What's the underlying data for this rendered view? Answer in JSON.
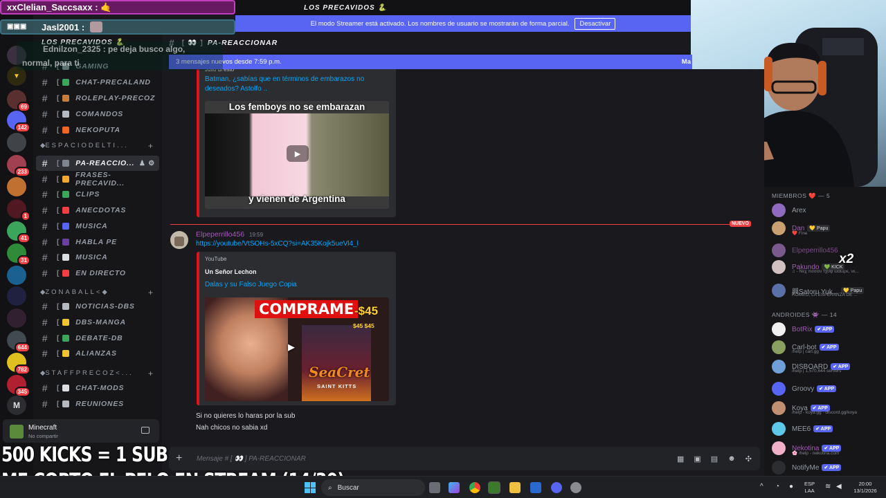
{
  "server": {
    "name": "LOS PRECAVIDOS 🐍",
    "title": "LOS PRECAVIDOS 🐍"
  },
  "streamer_bar": {
    "text": "El modo Streamer está activado. Los nombres de usuario se mostrarán de forma parcial.",
    "button": "Desactivar"
  },
  "channel_header": {
    "name": "PA-REACCIONAR",
    "bracket": "[ 👀 ]"
  },
  "new_messages": {
    "text": "3 mensajes nuevos desde 7:59 p.m.",
    "right": "Ma"
  },
  "rail_badges": [
    "69",
    "142",
    "233",
    "1",
    "41",
    "31",
    "644",
    "782",
    "345"
  ],
  "rail_letter": "M",
  "channels": [
    {
      "label": "GAMING",
      "color": "#949ba4"
    },
    {
      "label": "CHAT-PRECALAND",
      "color": "#3ba55c"
    },
    {
      "label": "ROLEPLAY-PRECOZ",
      "color": "#c77d3c"
    },
    {
      "label": "COMANDOS",
      "color": "#b5bac1"
    },
    {
      "label": "NEKOPUTA",
      "color": "#f26522"
    }
  ],
  "categories": [
    {
      "label": "ESPACIODELTI..."
    },
    {
      "label": "ZONABALL<◆"
    },
    {
      "label": "STAFFPRECOZ<..."
    }
  ],
  "espacio_channels": [
    {
      "label": "PA-REACCIO...",
      "color": "#80848e",
      "active": true
    },
    {
      "label": "FRASES-PRECAVID...",
      "color": "#f0a830"
    },
    {
      "label": "CLIPS",
      "color": "#3ba55c"
    },
    {
      "label": "ANECDOTAS",
      "color": "#f23f43"
    },
    {
      "label": "MUSICA",
      "color": "#5865f2"
    },
    {
      "label": "HABLA PE",
      "color": "#6b3fa0"
    },
    {
      "label": "MUSICA",
      "color": "#dbdee1"
    },
    {
      "label": "EN DIRECTO",
      "color": "#f23f43"
    }
  ],
  "zona_channels": [
    {
      "label": "NOTICIAS-DBS",
      "color": "#b5bac1"
    },
    {
      "label": "DBS-MANGA",
      "color": "#f0c330"
    },
    {
      "label": "DEBATE-DB",
      "color": "#3ba55c"
    },
    {
      "label": "ALIANZAS",
      "color": "#f0c330"
    }
  ],
  "staff_channels": [
    {
      "label": "CHAT-MODS",
      "color": "#dbdee1"
    },
    {
      "label": "REUNIONES",
      "color": "#b5bac1"
    }
  ],
  "activity": {
    "game": "Minecraft",
    "status": "No compartir"
  },
  "embed1": {
    "author": "Julio di esto",
    "title": "Batman, ¿sabías que en términos de embarazos no deseados? Astolfo ..",
    "thumb_top": "Los femboys no se embarazan",
    "thumb_bottom": "y vienen de Argentina"
  },
  "new_label": "NUEVO",
  "message2": {
    "username": "Elpeperrillo456",
    "time": "19:59",
    "link": "https://youtube/VtSOHs-5xCQ?si=AK35Kojk5ueVl4_l",
    "provider": "YouTube",
    "channel": "Un Señor Lechon",
    "title": "Dalas y su Falso Juego Copia",
    "thumb_big": "COMPRAME",
    "thumb_price": "-$45",
    "thumb_price2": "$45 $45",
    "thumb_logo": "SeaCret",
    "thumb_logo2": "SAINT KITTS"
  },
  "followups": [
    "Si no quieres lo haras por la sub",
    "Nah chicos no sabia xd"
  ],
  "composer": {
    "placeholder": "Mensaje # [ 👀 ] PA-REACCIONAR",
    "plus": "+"
  },
  "members_header": "MIEMBROS ❤️ — 5",
  "members": [
    {
      "name": "Arex",
      "sub": "",
      "pill": "",
      "color": "#8e6bbf"
    },
    {
      "name": "Dan",
      "sub": "❤️ Fine",
      "pill": "💛 Papu",
      "color": "#c9a070"
    },
    {
      "name": "Elpeperrillo456",
      "sub": "",
      "pill": "",
      "color": "#7a5a8c"
    },
    {
      "name": "Pakundo",
      "sub": "♫ - Nεχ πσσσυ τχυψ ωαωρε, νε...",
      "pill": "💚 KICK",
      "color": "#d0c0c0"
    },
    {
      "name": "興Satoru Yuk...",
      "sub": "ROMEO, LA ESPERANZA DE ...",
      "pill": "💛 Papu",
      "color": "#5b6fa8"
    }
  ],
  "androids_header": "ANDROIDES 👾 — 14",
  "bots": [
    {
      "name": "BotRix",
      "sub": "",
      "color": "#f0f0f0"
    },
    {
      "name": "Carl-bot",
      "sub": "/help | carl.gg",
      "color": "#8aa060"
    },
    {
      "name": "DISBOARD",
      "sub": "/help | 1,570,644 servers",
      "color": "#6fa0d8"
    },
    {
      "name": "Groovy",
      "sub": "",
      "color": "#5865f2"
    },
    {
      "name": "Koya",
      "sub": "/help - koya.gg · discord.gg/koya",
      "color": "#c09070"
    },
    {
      "name": "MEE6",
      "sub": "",
      "color": "#5ec8e8"
    },
    {
      "name": "Nekotina",
      "sub": "🌸 /help - nekotina.com",
      "color": "#f0b0c8"
    },
    {
      "name": "NotifyMe",
      "sub": "",
      "color": "#2b2d31"
    }
  ],
  "bot_tag": "✔ APP",
  "overlay": {
    "chat1": "xxClelian_Saccsaxx : 🤙",
    "chat2": "Jasl2001 :",
    "chat3": "Ednilzon_2325 : pe deja busco algo,",
    "chat3b": "normal, para ti",
    "line1": "500 KICKS = 1 SUB",
    "line2": "ME CORTO EL PELO EN STREAM (14/30)",
    "x2": "x2"
  },
  "taskbar": {
    "search": "Buscar",
    "lang": "ESP",
    "lang2": "LAA",
    "time": "20:00",
    "date": "13/1/2026"
  },
  "colors": {
    "accent": "#5865f2",
    "embed_border": "#e0131a",
    "new_red": "#f23f43"
  }
}
